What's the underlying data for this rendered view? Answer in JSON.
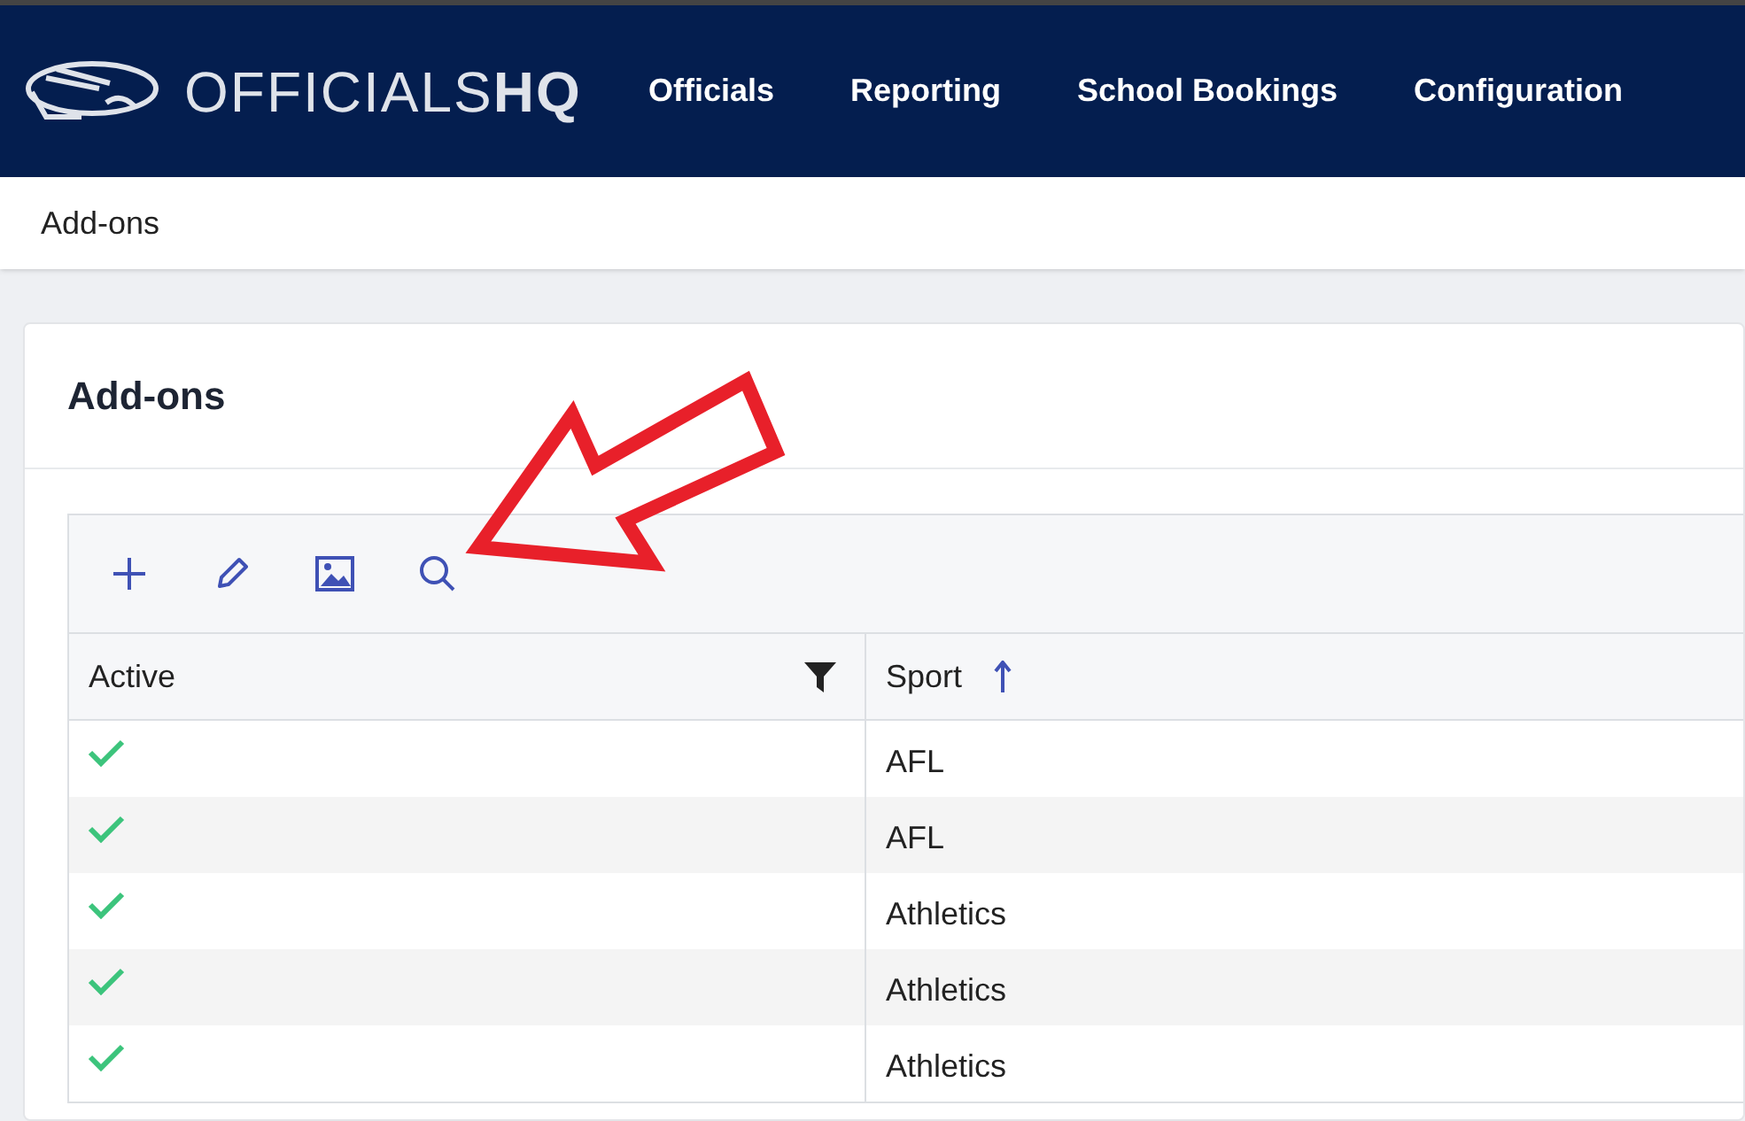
{
  "header": {
    "brand": {
      "light": "OFFICIALS",
      "bold": "HQ"
    },
    "nav": [
      {
        "label": "Officials"
      },
      {
        "label": "Reporting"
      },
      {
        "label": "School Bookings"
      },
      {
        "label": "Configuration"
      }
    ]
  },
  "breadcrumb": "Add-ons",
  "card": {
    "title": "Add-ons",
    "toolbar": [
      {
        "kind": "add"
      },
      {
        "kind": "edit"
      },
      {
        "kind": "image"
      },
      {
        "kind": "search"
      }
    ],
    "table": {
      "columns": [
        {
          "label": "Active",
          "filter": true
        },
        {
          "label": "Sport",
          "sorted_ascending": true
        }
      ],
      "rows": [
        {
          "active": true,
          "sport": "AFL"
        },
        {
          "active": true,
          "sport": "AFL"
        },
        {
          "active": true,
          "sport": "Athletics"
        },
        {
          "active": true,
          "sport": "Athletics"
        },
        {
          "active": true,
          "sport": "Athletics"
        }
      ]
    }
  }
}
